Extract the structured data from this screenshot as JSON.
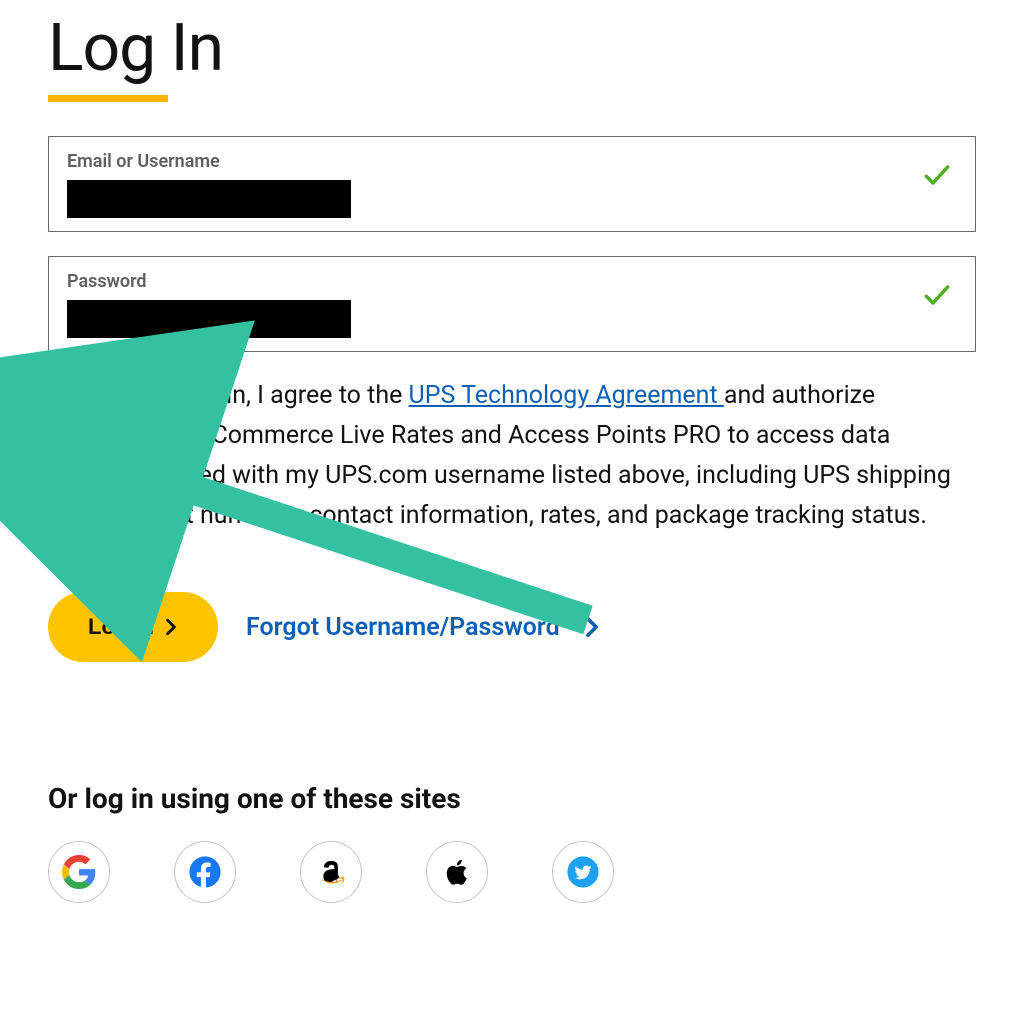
{
  "title": "Log In",
  "fields": {
    "username": {
      "label": "Email or Username",
      "valid": true
    },
    "password": {
      "label": "Password",
      "valid": true
    }
  },
  "consent": {
    "checked": true,
    "pre": "By logging in, I agree to the ",
    "link_text": "UPS Technology Agreement ",
    "post": "and authorize UPS/WooCommerce Live Rates and Access Points PRO to access data associated with my UPS.com username listed above, including UPS shipping account numbers, contact information, rates, and package tracking status."
  },
  "actions": {
    "login_label": "Log In",
    "forgot_label": "Forgot Username/Password"
  },
  "alt": {
    "heading": "Or log in using one of these sites",
    "providers": [
      "google",
      "facebook",
      "amazon",
      "apple",
      "twitter"
    ]
  }
}
